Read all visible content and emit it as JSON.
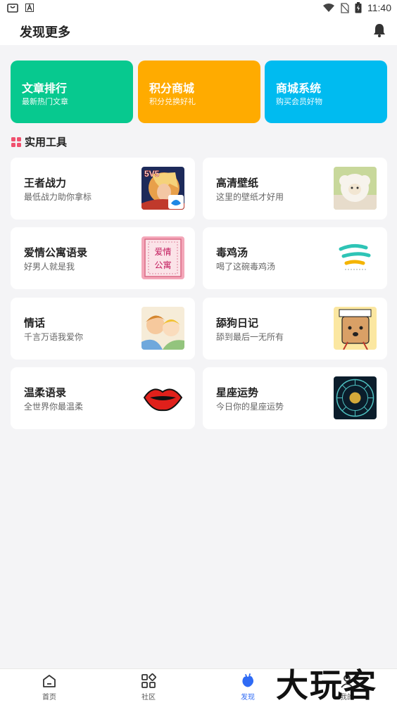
{
  "status_bar": {
    "time": "11:40",
    "battery_icon": "battery-charging-icon"
  },
  "header": {
    "title": "发现更多"
  },
  "feature_cards": [
    {
      "title": "文章排行",
      "subtitle": "最新热门文章",
      "color": "#07c98f"
    },
    {
      "title": "积分商城",
      "subtitle": "积分兑换好礼",
      "color": "#ffab00"
    },
    {
      "title": "商城系统",
      "subtitle": "购买会员好物",
      "color": "#00bbf0"
    }
  ],
  "section": {
    "title": "实用工具",
    "icon_color": "#f0506e"
  },
  "tools": [
    {
      "title": "王者战力",
      "subtitle": "最低战力助你拿标",
      "thumb_text": "5V5"
    },
    {
      "title": "高清壁纸",
      "subtitle": "这里的壁纸才好用"
    },
    {
      "title": "爱情公寓语录",
      "subtitle": "好男人就是我",
      "thumb_text_1": "爱情",
      "thumb_text_2": "公寓"
    },
    {
      "title": "毒鸡汤",
      "subtitle": "喝了这碗毒鸡汤"
    },
    {
      "title": "情话",
      "subtitle": "千言万语我爱你"
    },
    {
      "title": "舔狗日记",
      "subtitle": "舔到最后一无所有"
    },
    {
      "title": "温柔语录",
      "subtitle": "全世界你最温柔"
    },
    {
      "title": "星座运势",
      "subtitle": "今日你的星座运势"
    }
  ],
  "bottom_nav": [
    {
      "label": "首页",
      "icon": "home-icon"
    },
    {
      "label": "社区",
      "icon": "grid-icon"
    },
    {
      "label": "发现",
      "icon": "discover-icon",
      "active": true
    },
    {
      "label": "我的",
      "icon": "user-icon"
    }
  ],
  "watermark": "大玩客",
  "accent_color": "#2f6bf5"
}
